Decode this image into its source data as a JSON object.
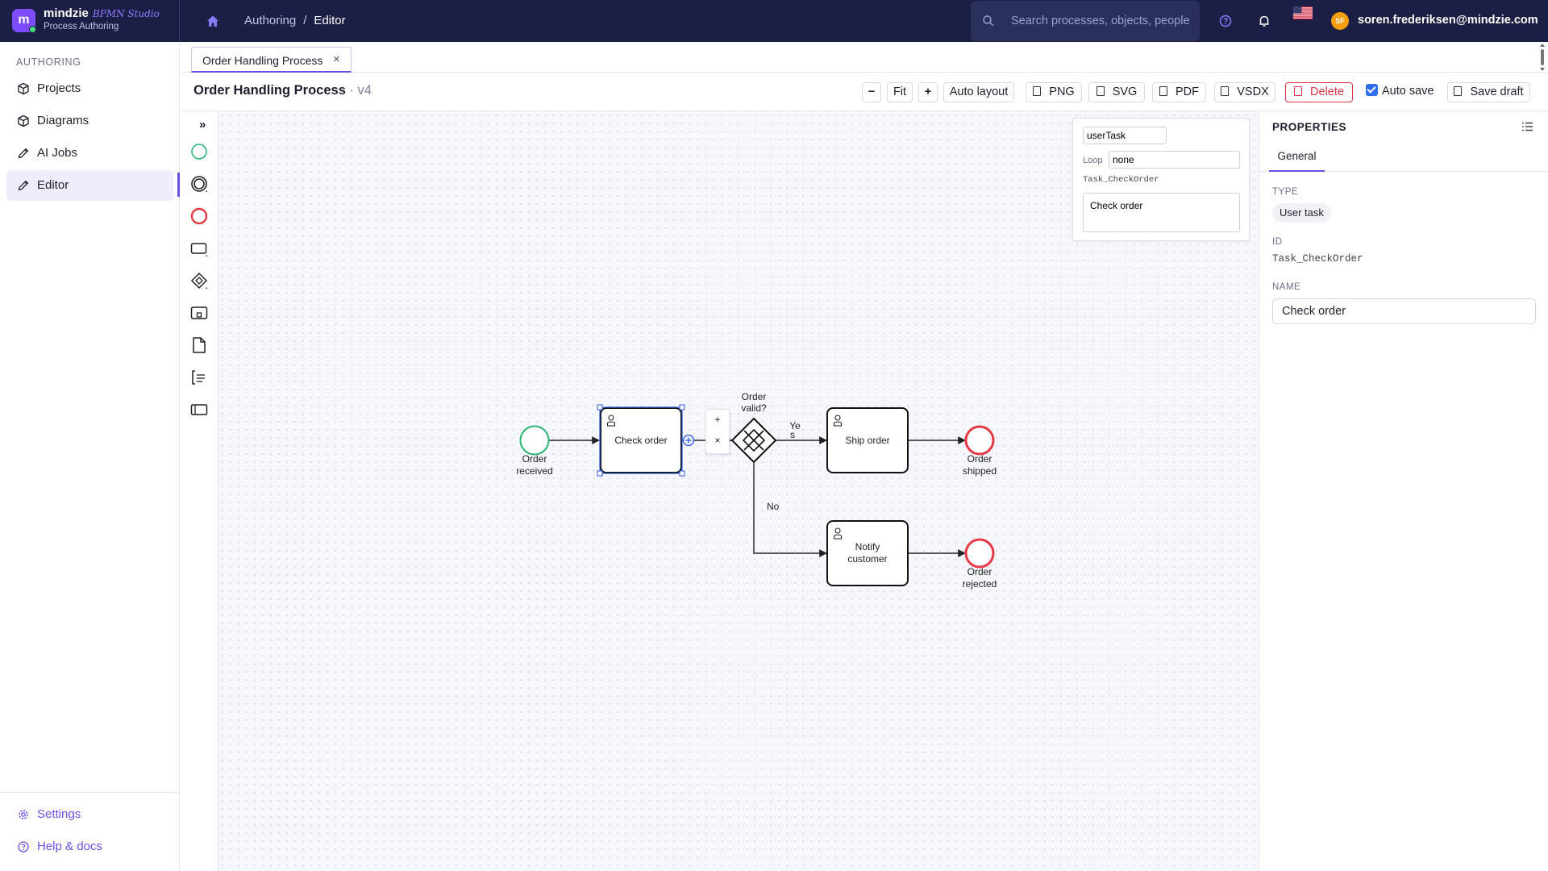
{
  "brand": {
    "name": "mindzie",
    "studio": "BPMN Studio",
    "subtitle": "Process Authoring",
    "logo_letter": "m"
  },
  "breadcrumb": {
    "parent": "Authoring",
    "separator": "/",
    "current": "Editor"
  },
  "search": {
    "placeholder": "Search processes, objects, people"
  },
  "user": {
    "initials": "SF",
    "email": "soren.frederiksen@mindzie.com"
  },
  "sidebar": {
    "heading": "AUTHORING",
    "items": [
      {
        "label": "Projects",
        "icon": "cube-icon"
      },
      {
        "label": "Diagrams",
        "icon": "cube-icon"
      },
      {
        "label": "AI Jobs",
        "icon": "pencil-icon"
      },
      {
        "label": "Editor",
        "icon": "pencil-icon",
        "active": true
      }
    ],
    "bottom": [
      {
        "label": "Settings",
        "icon": "gear-icon"
      },
      {
        "label": "Help & docs",
        "icon": "help-icon"
      }
    ]
  },
  "tab": {
    "label": "Order Handling Process",
    "close": "×"
  },
  "toolbar": {
    "title": "Order Handling Process",
    "version": " · v4",
    "zoom_out": "−",
    "fit": "Fit",
    "zoom_in": "+",
    "auto_layout": "Auto layout",
    "png": "PNG",
    "svg": "SVG",
    "pdf": "PDF",
    "vsdx": "VSDX",
    "delete": "Delete",
    "auto_save": "Auto save",
    "save_draft": "Save draft"
  },
  "palette": {
    "toggle": "»"
  },
  "diagram": {
    "start_event": [
      "Order",
      "received"
    ],
    "task_check": "Check order",
    "gateway": [
      "Order",
      "valid?"
    ],
    "yes": [
      "Ye",
      "s"
    ],
    "no": "No",
    "task_ship": "Ship order",
    "task_notify": [
      "Notify",
      "customer"
    ],
    "end_shipped": [
      "Order",
      "shipped"
    ],
    "end_rejected": [
      "Order",
      "rejected"
    ],
    "context_pad": {
      "append": "+",
      "remove": "×"
    }
  },
  "inline_editor": {
    "type": "userTask",
    "loop_label": "Loop",
    "loop": "none",
    "id": "Task_CheckOrder",
    "name": "Check order"
  },
  "properties": {
    "title": "PROPERTIES",
    "tab": "General",
    "type_label": "TYPE",
    "type": "User task",
    "id_label": "ID",
    "id": "Task_CheckOrder",
    "name_label": "NAME",
    "name": "Check order"
  },
  "colors": {
    "accent": "#6c4de6",
    "topbar": "#1c1f45",
    "start": "#2bb673",
    "end": "#e53945",
    "selection": "#2b56e0",
    "danger": "#dc3545"
  }
}
